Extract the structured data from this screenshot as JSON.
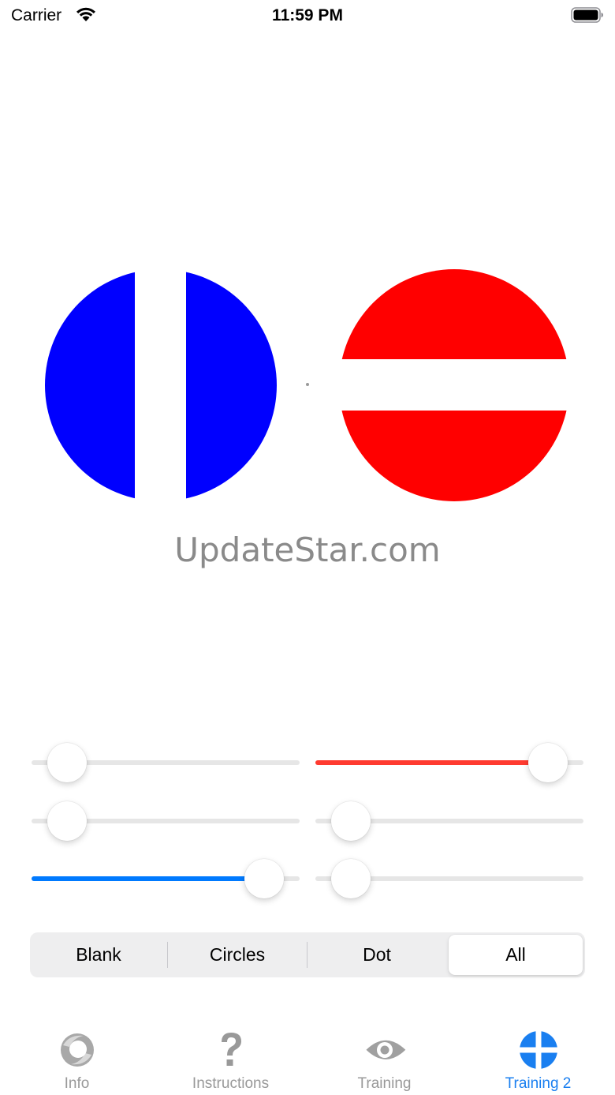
{
  "status_bar": {
    "carrier": "Carrier",
    "time": "11:59 PM"
  },
  "stimulus": {
    "left_circle_color": "#0000ff",
    "right_circle_color": "#ff0000",
    "watermark": "UpdateStar.com"
  },
  "sliders": [
    {
      "id": "left-1",
      "value": 0.07,
      "fill_color": ""
    },
    {
      "id": "right-1",
      "value": 0.93,
      "fill_color": "#ff3b30"
    },
    {
      "id": "left-2",
      "value": 0.07,
      "fill_color": ""
    },
    {
      "id": "right-2",
      "value": 0.07,
      "fill_color": ""
    },
    {
      "id": "left-3",
      "value": 0.93,
      "fill_color": "#007aff"
    },
    {
      "id": "right-3",
      "value": 0.07,
      "fill_color": ""
    }
  ],
  "segmented": {
    "options": [
      "Blank",
      "Circles",
      "Dot",
      "All"
    ],
    "selected": "All"
  },
  "tabs": [
    {
      "label": "Info",
      "icon": "swirl-icon",
      "active": false
    },
    {
      "label": "Instructions",
      "icon": "question-mark-icon",
      "active": false
    },
    {
      "label": "Training",
      "icon": "eye-icon",
      "active": false
    },
    {
      "label": "Training 2",
      "icon": "crosshair-circle-icon",
      "active": true
    }
  ],
  "colors": {
    "accent": "#1a7ff0",
    "inactive_tab": "#999999"
  }
}
